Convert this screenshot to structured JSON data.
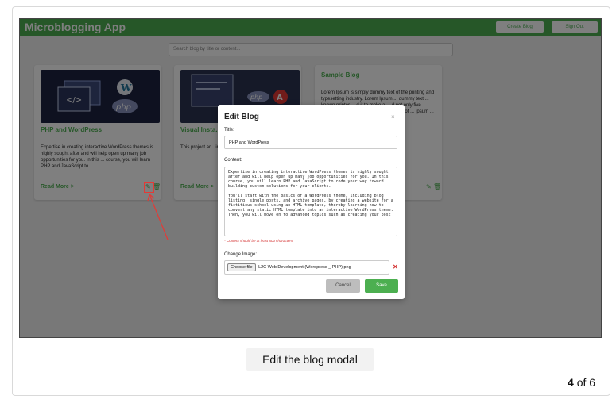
{
  "app": {
    "brand": "Microblogging App",
    "nav": {
      "create_label": "Create Blog",
      "signout_label": "Sign Out"
    },
    "search_placeholder": "Search blog by title or content..."
  },
  "cards": [
    {
      "title": "PHP and WordPress",
      "text": "Expertise in creating interactive WordPress themes is highly sought after and will help open up many job opportunities for you. In this ... course, you will learn PHP and JavaScript to",
      "read_more": "Read More >"
    },
    {
      "title": "Visual Insta... Ansible, PH...",
      "text": "This project ar... interface applic... PHP, and Web...",
      "read_more": "Read More >"
    },
    {
      "title": "Sample Blog",
      "text": "Lorem Ipsum is simply dummy text of the printing and typesetting industry. Lorem Ipsum ... dummy text ... known printer ... d it to make a ... d not only five ... ectronic ... unchanged. It ... the release of ... Ipsum ... desktop ... eMaker",
      "read_more": ""
    }
  ],
  "modal": {
    "title": "Edit Blog",
    "close": "×",
    "title_label": "Title:",
    "title_value": "PHP and WordPress",
    "content_label": "Content:",
    "content_value": "Expertise in creating interactive WordPress themes is highly sought after and will help open up many job opportunities for you. In this course, you will learn PHP and JavaScript to code your way toward building custom solutions for your clients.\n\nYou'll start with the basics of a WordPress theme, including blog listing, single posts, and archive pages, by creating a website for a fictitious school using an HTML template, thereby learning how to convert any static HTML template into an interactive WordPress theme. Then, you will move on to advanced topics such as creating your post",
    "hint": "* Content should be at least 500 characters.",
    "image_label": "Change Image:",
    "choose_label": "Choose file",
    "file_name": "L2C Web Development (Wordpress _ PHP).png",
    "remove": "✕",
    "cancel_label": "Cancel",
    "save_label": "Save"
  },
  "caption": "Edit the blog modal",
  "pager": {
    "current": "4",
    "of_label": "of 6"
  }
}
